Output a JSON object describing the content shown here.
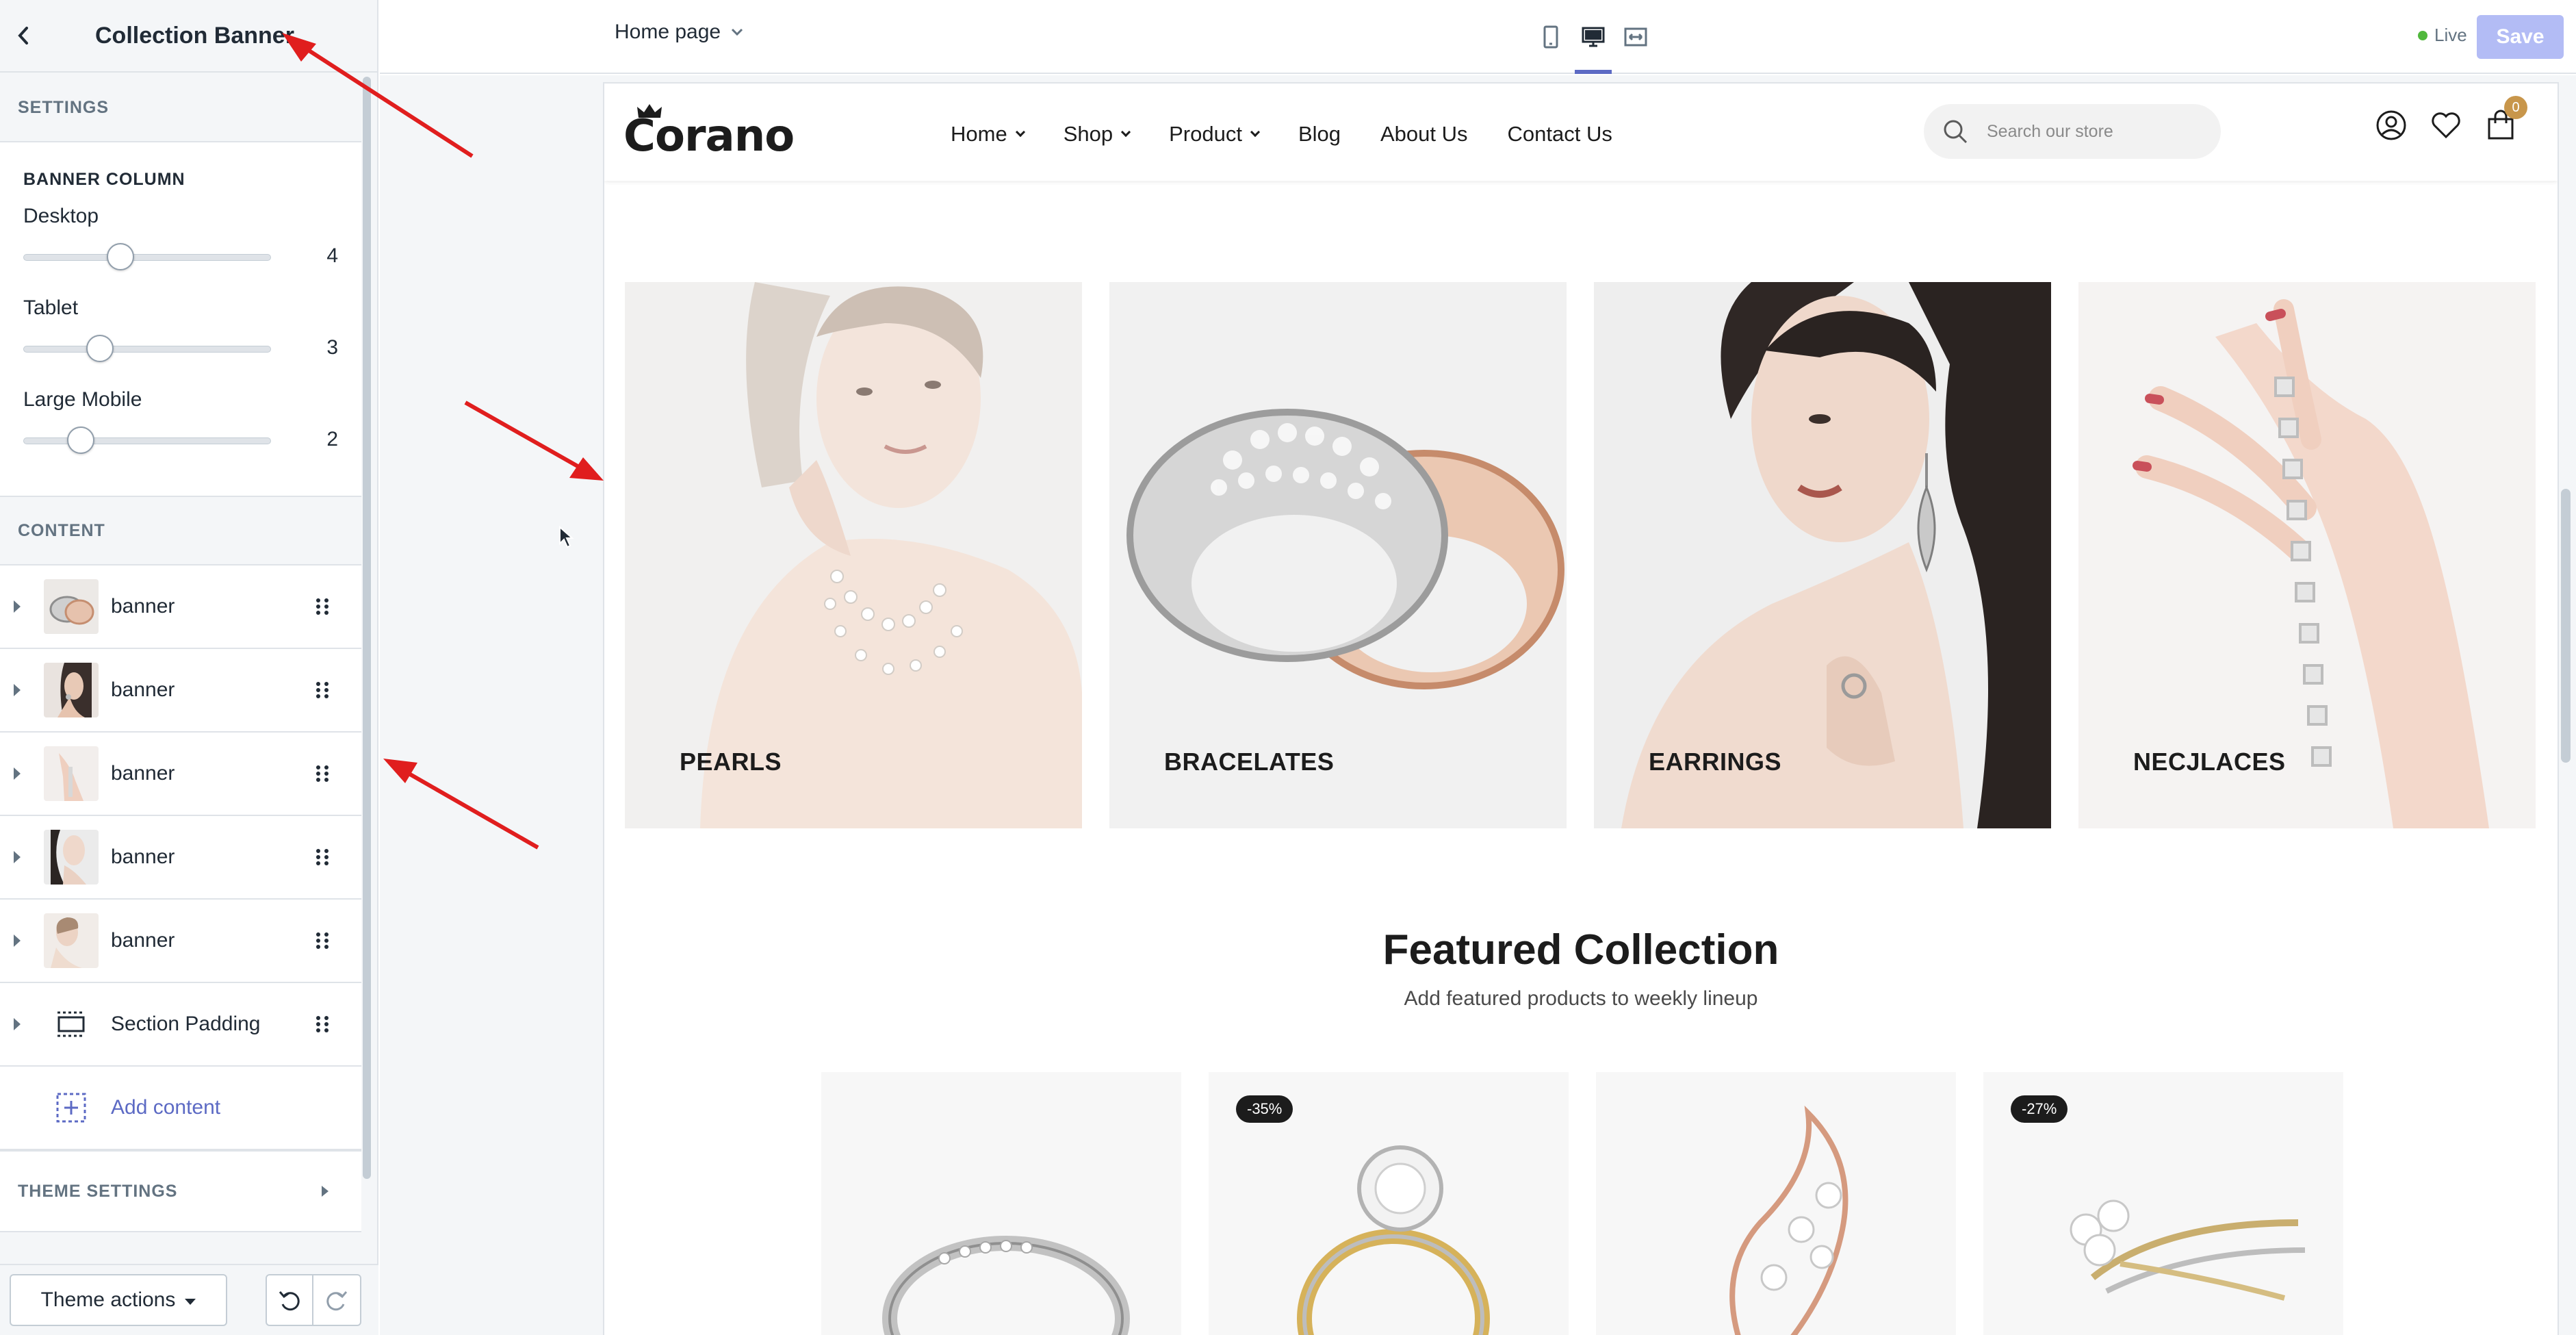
{
  "editor": {
    "panel_title": "Collection Banner",
    "settings_heading": "SETTINGS",
    "banner_column": {
      "heading": "BANNER COLUMN",
      "ranges": [
        {
          "label": "Desktop",
          "value": "4",
          "fraction": 0.3
        },
        {
          "label": "Tablet",
          "value": "3",
          "fraction": 0.2
        },
        {
          "label": "Large Mobile",
          "value": "2",
          "fraction": 0.13
        }
      ]
    },
    "content_heading": "CONTENT",
    "content_items": [
      {
        "label": "banner",
        "thumb": "rings"
      },
      {
        "label": "banner",
        "thumb": "earrings"
      },
      {
        "label": "banner",
        "thumb": "hand"
      },
      {
        "label": "banner",
        "thumb": "woman"
      },
      {
        "label": "banner",
        "thumb": "pearls"
      }
    ],
    "section_padding": "Section Padding",
    "add_content": "Add content",
    "theme_settings": "THEME SETTINGS",
    "theme_actions": "Theme actions"
  },
  "topbar": {
    "page_select": "Home page",
    "live_label": "Live",
    "save_label": "Save",
    "accent": "#5c6ac4"
  },
  "store": {
    "logo": "Corano",
    "nav": [
      {
        "label": "Home",
        "dropdown": true
      },
      {
        "label": "Shop",
        "dropdown": true
      },
      {
        "label": "Product",
        "dropdown": true
      },
      {
        "label": "Blog",
        "dropdown": false
      },
      {
        "label": "About Us",
        "dropdown": false
      },
      {
        "label": "Contact Us",
        "dropdown": false
      }
    ],
    "search_placeholder": "Search our store",
    "cart_count": "0",
    "banners": [
      {
        "label": "PEARLS"
      },
      {
        "label": "BRACELATES"
      },
      {
        "label": "EARRINGS"
      },
      {
        "label": "NECJLACES"
      }
    ],
    "featured_title": "Featured Collection",
    "featured_subtitle": "Add featured products to weekly lineup",
    "products": [
      {
        "badge": ""
      },
      {
        "badge": "-35%"
      },
      {
        "badge": ""
      },
      {
        "badge": "-27%"
      }
    ],
    "accent": "#c8964b"
  }
}
